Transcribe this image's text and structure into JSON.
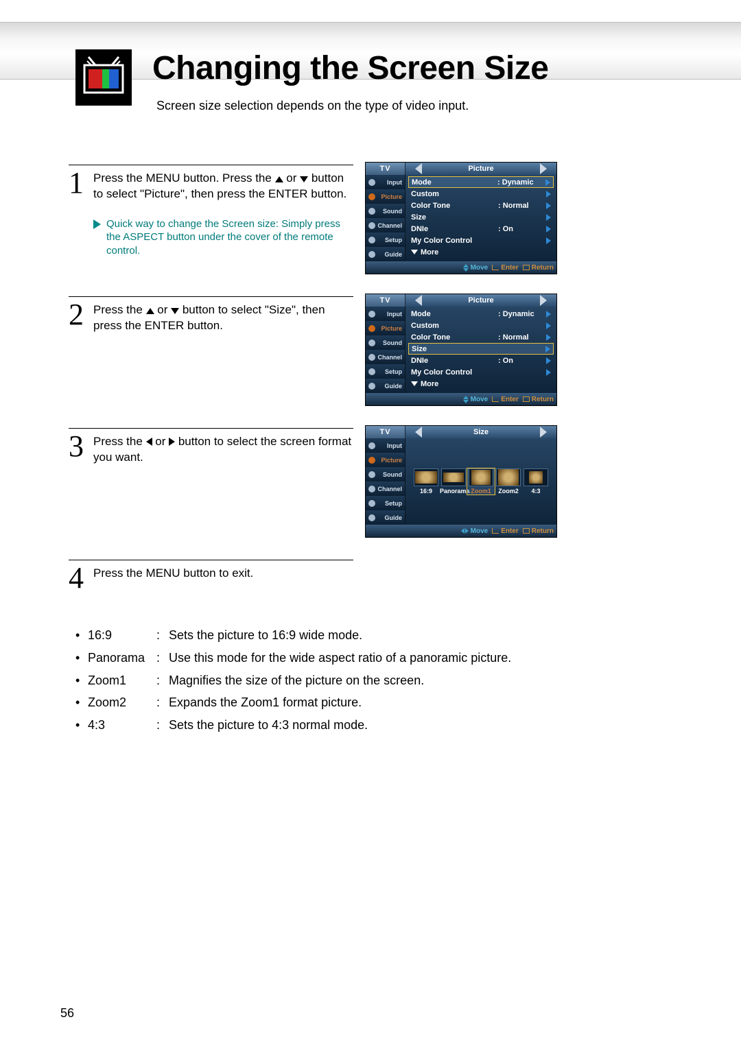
{
  "header": {
    "title": "Changing the Screen Size",
    "subtitle": "Screen size selection depends on the type of video input."
  },
  "steps": {
    "s1": {
      "num": "1",
      "text_a": "Press the MENU button. Press the ",
      "text_b": " or ",
      "text_c": " button to select \"Picture\", then press the ENTER button.",
      "tip": "Quick way to change the Screen size: Simply press the ASPECT button under the cover of the remote control."
    },
    "s2": {
      "num": "2",
      "text_a": "Press the ",
      "text_b": " or ",
      "text_c": " button to select \"Size\", then press the ENTER button."
    },
    "s3": {
      "num": "3",
      "text_a": "Press the ",
      "text_b": " or ",
      "text_c": " button to select the screen format you want."
    },
    "s4": {
      "num": "4",
      "text": "Press the MENU button to exit."
    }
  },
  "osd": {
    "source_label": "TV",
    "picture_title": "Picture",
    "size_title": "Size",
    "side_items": [
      "Input",
      "Picture",
      "Sound",
      "Channel",
      "Setup",
      "Guide"
    ],
    "rows": {
      "mode": "Mode",
      "mode_val": ": Dynamic",
      "custom": "Custom",
      "colortone": "Color Tone",
      "colortone_val": ": Normal",
      "size": "Size",
      "dnie": "DNIe",
      "dnie_val": ": On",
      "mycolor": "My Color Control",
      "more": "More"
    },
    "size_options": [
      "16:9",
      "Panorama",
      "Zoom1",
      "Zoom2",
      "4:3"
    ],
    "footer": {
      "move": "Move",
      "enter": "Enter",
      "return": "Return"
    }
  },
  "bullets": [
    {
      "key": "16:9",
      "desc": "Sets the picture to 16:9 wide mode."
    },
    {
      "key": "Panorama",
      "desc": "Use this mode for the wide aspect ratio of a panoramic picture."
    },
    {
      "key": "Zoom1",
      "desc": "Magnifies the size of the picture on the screen."
    },
    {
      "key": "Zoom2",
      "desc": "Expands the Zoom1 format picture."
    },
    {
      "key": "4:3",
      "desc": "Sets the picture to 4:3 normal mode."
    }
  ],
  "page_number": "56"
}
